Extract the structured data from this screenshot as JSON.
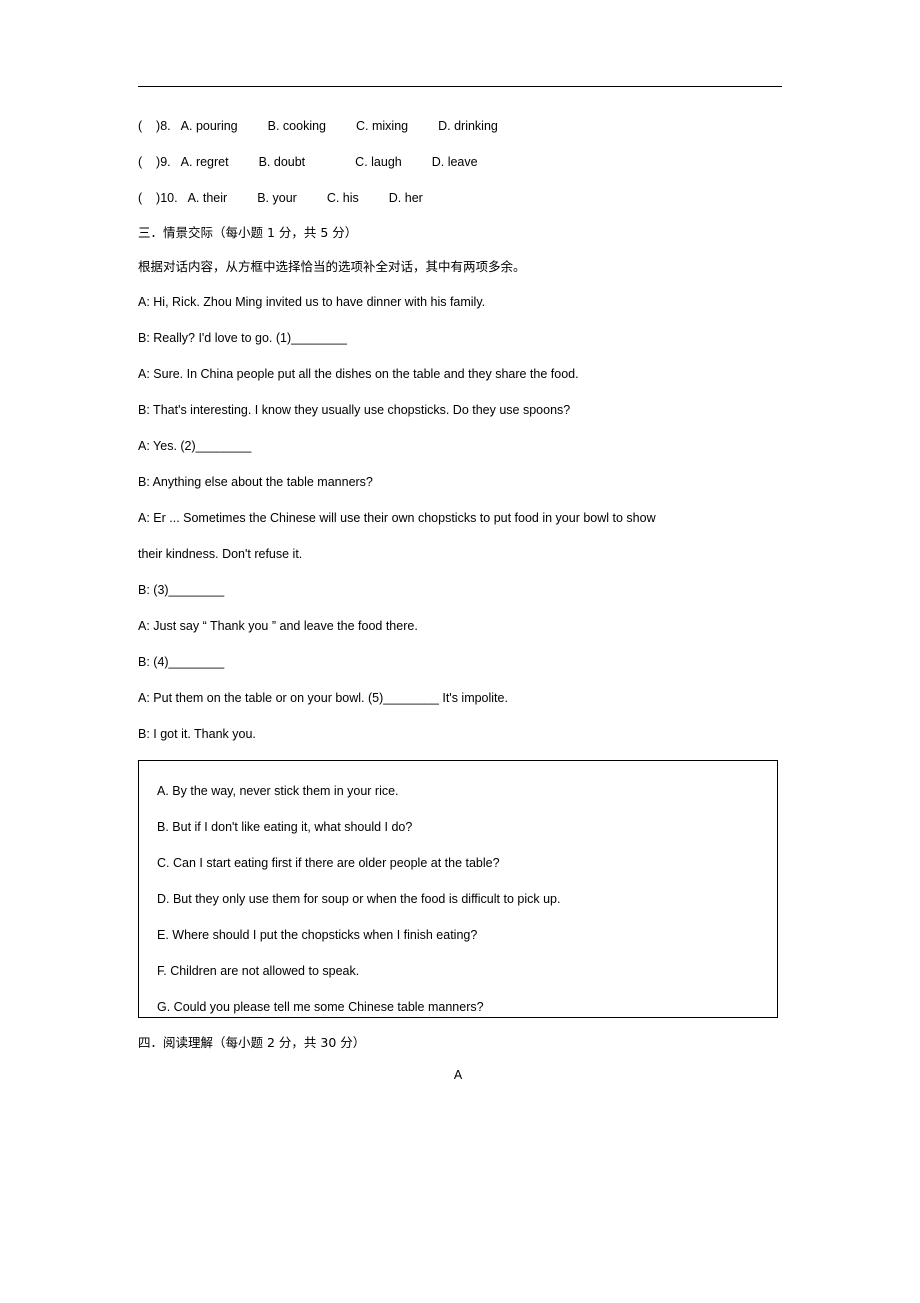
{
  "document": {
    "cloze_choices": [
      {
        "num": "(    )8.",
        "a": "A. pouring",
        "b": "B. cooking",
        "c": "C. mixing",
        "d": "D. drinking"
      },
      {
        "num": "(    )9.",
        "a": "A. regret",
        "b": "B. doubt",
        "c": "C. laugh",
        "d": "D. leave"
      },
      {
        "num": "(    )10.",
        "a": "A. their",
        "b": "B. your",
        "c": "C. his",
        "d": "D. her"
      }
    ],
    "section_three_title": "三．情景交际（每小题  1 分，共  5 分）",
    "section_three_instruction": "根据对话内容，从方框中选择恰当的选项补全对话，其中有两项多余。",
    "dialog": [
      "A: Hi, Rick. Zhou Ming invited us to have dinner with his family.",
      "B: Really? I'd love to go. (1)________",
      "A: Sure. In China people put all the dishes on the table and they share the food.",
      "B: That's interesting. I know they usually use chopsticks. Do they use spoons?",
      "A: Yes. (2)________",
      "B: Anything else about the table manners?",
      "A: Er ... Sometimes the Chinese will use their own chopsticks to put food in your bowl to show",
      "their kindness. Don't refuse it.",
      "B: (3)________",
      "A: Just say        “ Thank you    ”   and leave the food there.",
      "B: (4)________",
      "A: Put them on the table or on your bowl. (5)________ It's impolite.",
      "B: I got it. Thank you."
    ],
    "options_box": [
      "A. By the way, never stick them in your rice.",
      "B. But if I don't like eating it, what should I do?",
      "C. Can I start eating first if there are older people at the table?",
      "D. But they only use them for soup or when the food is difficult to pick up.",
      "E. Where should I put the chopsticks when I finish eating?",
      "F. Children are not allowed to speak.",
      "G. Could you please tell me some Chinese table manners?"
    ],
    "section_four_title": "四．阅读理解（每小题  2 分，共  30 分）",
    "passage_label": "A"
  }
}
